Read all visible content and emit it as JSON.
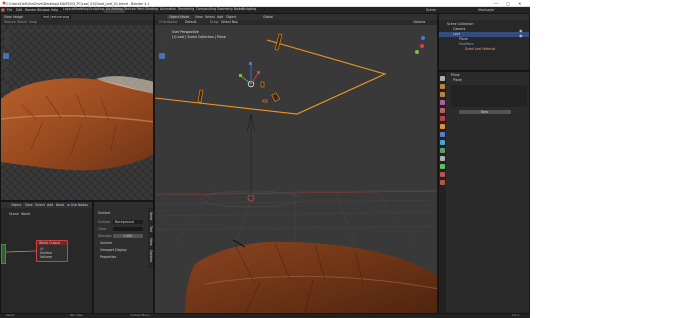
{
  "window": {
    "title": "C:\\Users\\Dell\\OneDrive\\Desktop\\LEAVES\\03_PC\\Leaf_01\\Dried_Leaf_01.blend - Blender 4.1",
    "controls": [
      "—",
      "▢",
      "✕"
    ]
  },
  "menubar": {
    "items": [
      "File",
      "Edit",
      "Render",
      "Window",
      "Help"
    ],
    "workspaces": [
      "Layout",
      "Modeling",
      "Sculpting",
      "UV Editing",
      "Texture Paint",
      "Shading",
      "Animation",
      "Rendering",
      "Compositing",
      "Geometry Nodes",
      "Scripting"
    ],
    "active_workspace": "UV Editing",
    "scene_label": "Scene",
    "view_layer_label": "ViewLayer"
  },
  "uv_editor": {
    "header": [
      "View",
      "Image"
    ],
    "image_name": "leaf_texture.png",
    "row2": [
      "Texture",
      "Select",
      "Snap"
    ]
  },
  "viewport": {
    "header": [
      "Object Mode",
      "View",
      "Select",
      "Add",
      "Object"
    ],
    "global_label": "Global",
    "row2": [
      "Orientation:",
      "Default",
      "Drag:",
      "Select Box"
    ],
    "perspective_title": "User Perspective",
    "collection_label": "(1) Leaf | Scene Collection | Plane",
    "options_label": "Options"
  },
  "node_editor": {
    "header": [
      "Object",
      "View",
      "Select",
      "Add",
      "Node",
      "Use Nodes",
      "World"
    ],
    "breadcrumb": [
      "Scene",
      "World"
    ],
    "node_title": "World Output",
    "node_sockets": [
      "All",
      "Surface",
      "Volume"
    ]
  },
  "world_panel": {
    "section": "Surface",
    "rows": [
      {
        "label": "Surface",
        "value": "Background"
      },
      {
        "label": "Color",
        "value": ""
      },
      {
        "label": "Strength",
        "value": "1.000"
      }
    ],
    "subsections": [
      "Volume",
      "Viewport Display",
      "Properties"
    ],
    "sidebar_tabs": [
      "Node",
      "Tool",
      "View",
      "Options"
    ]
  },
  "outliner": {
    "title": "Scene Collection",
    "items": [
      "Camera",
      "Leaf",
      "Plane",
      "Modifiers",
      "Dried Leaf Material"
    ]
  },
  "properties": {
    "header": "Plane",
    "panel_label": "Plane",
    "button_label": "New"
  },
  "statusbar": {
    "items": [
      "Select",
      "Pan View",
      "Context Menu"
    ],
    "version": "4.1.0"
  }
}
